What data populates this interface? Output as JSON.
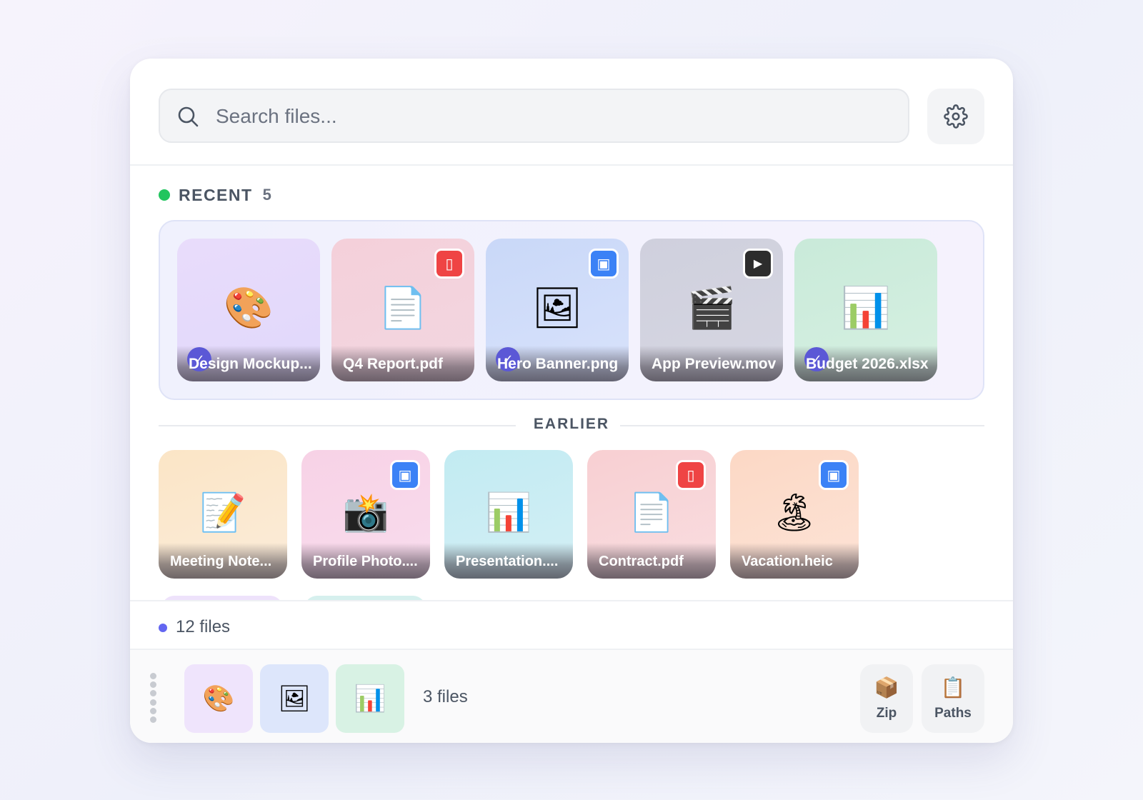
{
  "search": {
    "placeholder": "Search files..."
  },
  "icons": {
    "search": "search-icon",
    "settings": "gear-icon"
  },
  "recent": {
    "title": "RECENT",
    "count": "5",
    "status_color": "#22c55e",
    "items": [
      {
        "name": "Design Mockup...",
        "icon": "🎨",
        "selected": true,
        "badge": "",
        "bg": "linear-gradient(160deg,#e9dcfb,#e0d8fb)"
      },
      {
        "name": "Q4 Report.pdf",
        "icon": "📄",
        "selected": false,
        "badge": "pdf-icon",
        "badge_glyph": "▯",
        "badge_color": "#ef4444",
        "bg": "linear-gradient(160deg,#f4d0da,#f2d6e0)"
      },
      {
        "name": "Hero Banner.png",
        "icon": "🖼",
        "selected": true,
        "badge": "image-icon",
        "badge_glyph": "▣",
        "badge_color": "#3b82f6",
        "bg": "linear-gradient(160deg,#c9d8f8,#d8e2fb)"
      },
      {
        "name": "App Preview.mov",
        "icon": "🎬",
        "selected": false,
        "badge": "play-icon",
        "badge_glyph": "▶",
        "badge_color": "#2d2d2d",
        "bg": "linear-gradient(160deg,#cfd0dd,#d6d6e2)"
      },
      {
        "name": "Budget 2026.xlsx",
        "icon": "📊",
        "selected": true,
        "badge": "",
        "bg": "linear-gradient(160deg,#c9ead9,#d6f0e2)"
      }
    ]
  },
  "earlier": {
    "title": "EARLIER",
    "items": [
      {
        "name": "Meeting Note...",
        "icon": "📝",
        "badge": "",
        "bg": "linear-gradient(160deg,#fbe5c6,#fbecd9)"
      },
      {
        "name": "Profile Photo....",
        "icon": "📸",
        "badge": "image-icon",
        "badge_glyph": "▣",
        "badge_color": "#3b82f6",
        "bg": "linear-gradient(160deg,#f7d2e6,#f9dced)"
      },
      {
        "name": "Presentation....",
        "icon": "📊",
        "badge": "",
        "bg": "linear-gradient(160deg,#c2ebf2,#d3eff5)"
      },
      {
        "name": "Contract.pdf",
        "icon": "📄",
        "badge": "pdf-icon",
        "badge_glyph": "▯",
        "badge_color": "#ef4444",
        "bg": "linear-gradient(160deg,#f8cfd2,#f9dde0)"
      },
      {
        "name": "Vacation.heic",
        "icon": "🏝",
        "badge": "image-icon",
        "badge_glyph": "▣",
        "badge_color": "#3b82f6",
        "bg": "linear-gradient(160deg,#fcd8c5,#fde3d6)"
      }
    ]
  },
  "status": {
    "text": "12 files",
    "dot_color": "#6366f1"
  },
  "tray": {
    "thumbs": [
      {
        "icon": "🎨",
        "bg": "#efe4fc"
      },
      {
        "icon": "🖼",
        "bg": "#dde6fb"
      },
      {
        "icon": "📊",
        "bg": "#d8f2e4"
      }
    ],
    "count": "3 files",
    "actions": [
      {
        "label": "Zip",
        "icon": "📦"
      },
      {
        "label": "Paths",
        "icon": "📋"
      }
    ]
  }
}
